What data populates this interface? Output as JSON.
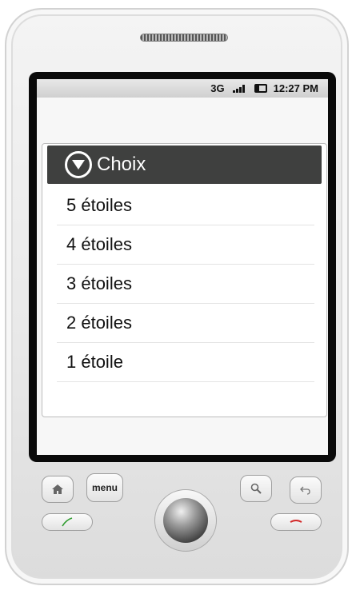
{
  "status_bar": {
    "network": "3G",
    "time": "12:27 PM"
  },
  "dialog": {
    "title": "Choix",
    "title_icon": "circle-down-arrow-icon",
    "options": [
      {
        "label": "5 étoiles"
      },
      {
        "label": "4 étoiles"
      },
      {
        "label": "3 étoiles"
      },
      {
        "label": "2 étoiles"
      },
      {
        "label": "1 étoile"
      }
    ]
  },
  "hardware_buttons": {
    "menu_label": "menu",
    "home_icon": "home-icon",
    "search_icon": "search-icon",
    "back_icon": "back-arrow-icon",
    "call_icon": "call-icon",
    "end_call_icon": "end-call-icon"
  },
  "colors": {
    "title_bar": "#3f403f",
    "screen_bg": "#f7f7f7",
    "call_green": "#2e9b2e",
    "end_red": "#d22a2a"
  }
}
